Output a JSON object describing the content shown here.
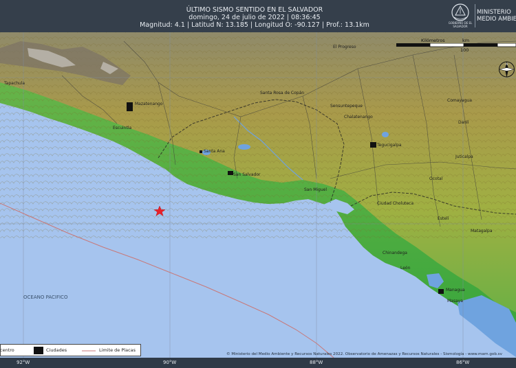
{
  "header": {
    "title": "ÚLTIMO SISMO SENTIDO EN EL SALVADOR",
    "datetime": "domingo, 24 de julio de 2022 | 08:36:45",
    "details": "Magnitud: 4.1 | Latitud N: 13.185 | Longitud O: -90.127 | Prof.: 13.1km",
    "logo_caption": "GOBIERNO DE EL SALVADOR",
    "ministry_line1": "MINISTERIO",
    "ministry_line2": "MEDIO AMBIENTE"
  },
  "places": {
    "tapachula": "Tapachula",
    "el_progreso": "El Progreso",
    "quetzaltenango": "Mazatenango",
    "escuintla": "Escuintla",
    "santa_rosa": "Santa Rosa de Copán",
    "sensuntepeque": "Sensuntepeque",
    "chalatenango": "Chalatenango",
    "tegucigalpa": "Tegucigalpa",
    "comayagua": "Comayagua",
    "santa_ana": "Santa Ana",
    "san_salvador": "San Salvador",
    "san_miguel": "San Miguel",
    "juticalpa": "Juticalpa",
    "danli": "Danlí",
    "ocotal": "Ocotal",
    "ciudad_choluteca": "Ciudad Choluteca",
    "esteli": "Estelí",
    "matagalpa": "Matagalpa",
    "chinandega": "Chinandega",
    "leon": "León",
    "managua": "Managua",
    "masaya": "Masaya",
    "ocean": "OCEANO PACIFICO"
  },
  "scale": {
    "unit": "Kilómetros",
    "km": "km",
    "mark_100": "100"
  },
  "compass_letter": "N",
  "legend": {
    "epicenter": "Epicentro",
    "cities": "Ciudades",
    "plates": "Limite de Placas"
  },
  "credits": "© Ministerio del Medio Ambiente y Recursos Naturales 2022. Observatorio de Amenazas y Recursos Naturales - Sismología - www.marn.gob.sv",
  "longitudes": [
    "92°W",
    "90°W",
    "88°W",
    "86°W"
  ],
  "colors": {
    "ocean": "#a6c4ee",
    "epicenter": "#e8202a",
    "plate_boundary": "#c87878",
    "header_bg": "#353f4b"
  },
  "earthquake": {
    "magnitude": 4.1,
    "latitude_n": 13.185,
    "longitude_o": -90.127,
    "depth_km": 13.1
  }
}
